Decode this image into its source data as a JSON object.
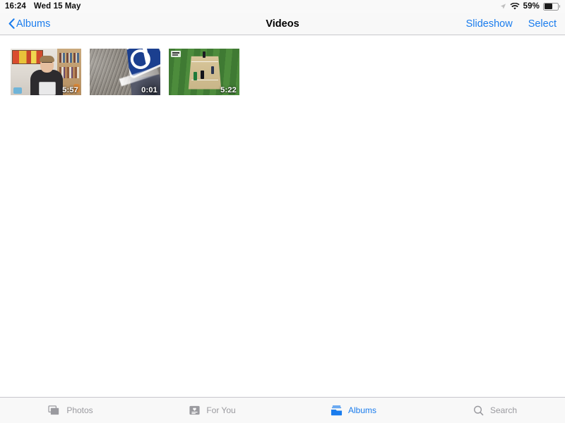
{
  "status_bar": {
    "time": "16:24",
    "date": "Wed 15 May",
    "location_icon": "location-arrow-icon",
    "wifi_icon": "wifi-icon",
    "battery_percent": "59%",
    "battery_level": 59,
    "battery_icon": "battery-icon"
  },
  "nav_bar": {
    "back_label": "Albums",
    "back_icon": "chevron-left-icon",
    "title": "Videos",
    "slideshow_label": "Slideshow",
    "select_label": "Select",
    "tint_color": "#1a7ced"
  },
  "videos": [
    {
      "name": "video-thumbnail-1",
      "duration": "5:57",
      "description": "Person seated holding a tablet in a room with colourful wall art and a bookshelf"
    },
    {
      "name": "video-thumbnail-2",
      "duration": "0:01",
      "description": "Close-up of a grey concrete post with a blue and white road sign"
    },
    {
      "name": "video-thumbnail-3",
      "duration": "5:22",
      "description": "Cricket match on a green field with a tan pitch and players"
    }
  ],
  "tab_bar": {
    "tabs": [
      {
        "label": "Photos",
        "icon": "photos-stack-icon",
        "active": false
      },
      {
        "label": "For You",
        "icon": "for-you-card-icon",
        "active": false
      },
      {
        "label": "Albums",
        "icon": "albums-folder-icon",
        "active": true
      },
      {
        "label": "Search",
        "icon": "search-magnifier-icon",
        "active": false
      }
    ],
    "active_color": "#1a7ced",
    "inactive_color": "#9a9a9f"
  }
}
